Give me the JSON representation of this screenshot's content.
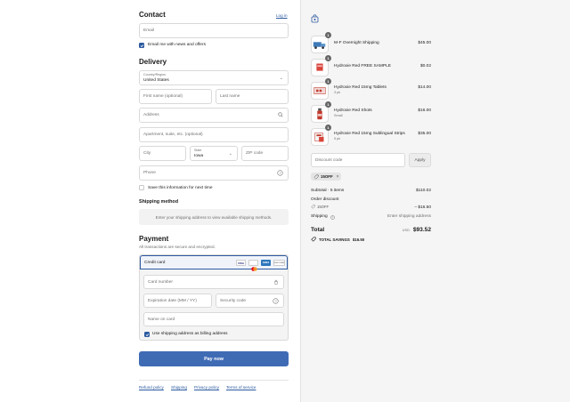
{
  "contact": {
    "title": "Contact",
    "login_link": "Log in",
    "email_placeholder": "Email",
    "news_label": "Email me with news and offers"
  },
  "delivery": {
    "title": "Delivery",
    "country_label": "Country/Region",
    "country_value": "United States",
    "first_name_placeholder": "First name (optional)",
    "last_name_placeholder": "Last name",
    "address_placeholder": "Address",
    "apartment_placeholder": "Apartment, suite, etc. (optional)",
    "city_placeholder": "City",
    "state_label": "State",
    "state_value": "Iowa",
    "zip_placeholder": "ZIP code",
    "phone_placeholder": "Phone",
    "save_label": "Save this information for next time"
  },
  "shipping_method": {
    "title": "Shipping method",
    "message": "Enter your shipping address to view available shipping methods."
  },
  "payment": {
    "title": "Payment",
    "subtitle": "All transactions are secure and encrypted.",
    "method_label": "Credit card",
    "card_brands": [
      "VISA",
      "MC",
      "AMEX",
      "DISCOVER"
    ],
    "card_number_placeholder": "Card number",
    "expiry_placeholder": "Expiration date (MM / YY)",
    "security_placeholder": "Security code",
    "name_placeholder": "Name on card",
    "billing_label": "Use shipping address as billing address",
    "pay_button": "Pay now"
  },
  "footer_links": [
    "Refund policy",
    "Shipping",
    "Privacy policy",
    "Terms of service"
  ],
  "cart": {
    "items": [
      {
        "name": "M-F Overnight Shipping",
        "variant": "",
        "price": "$45.00",
        "qty": "1",
        "icon": "truck-icon"
      },
      {
        "name": "Hydroxie Red FREE SAMPLE",
        "variant": "",
        "price": "$0.02",
        "qty": "1",
        "icon": "sample-pack-icon"
      },
      {
        "name": "Hydroxie Red 15mg Tablets",
        "variant": "3 pk",
        "price": "$14.00",
        "qty": "1",
        "icon": "tablets-icon"
      },
      {
        "name": "Hydroxie Red Shots",
        "variant": "Small",
        "price": "$16.00",
        "qty": "1",
        "icon": "bottle-icon"
      },
      {
        "name": "Hydroxie Red 15mg Sublingual Strips",
        "variant": "5 pk",
        "price": "$35.00",
        "qty": "1",
        "icon": "strips-icon"
      }
    ],
    "discount_placeholder": "Discount code",
    "apply_button": "Apply",
    "applied_code": "15OFF",
    "subtotal_label": "Subtotal · 5 items",
    "subtotal_value": "$110.02",
    "order_discount_label": "Order discount",
    "order_discount_code": "15OFF",
    "order_discount_value": "– $16.50",
    "shipping_label": "Shipping",
    "shipping_value": "Enter shipping address",
    "total_label": "Total",
    "currency": "USD",
    "total_value": "$93.52",
    "savings_label": "TOTAL SAVINGS",
    "savings_value": "$16.50"
  },
  "colors": {
    "accent": "#2c5aa0",
    "pay_button": "#3f6bb5",
    "panel_bg": "#f5f5f5"
  }
}
